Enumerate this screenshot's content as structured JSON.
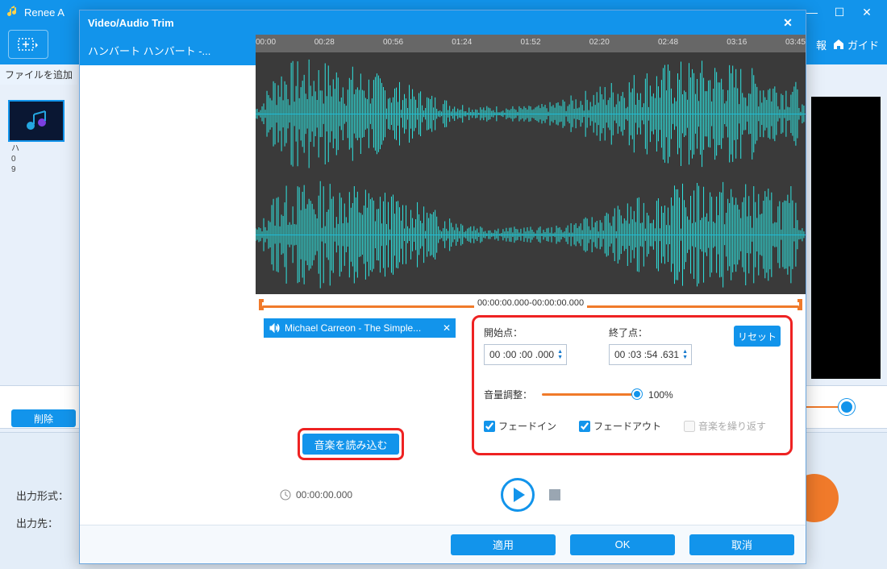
{
  "app": {
    "title": "Renee A",
    "add_file_label": "ファイルを追加",
    "toolbar_info": "報",
    "toolbar_guide": "ガイド"
  },
  "file_item": {
    "line1": "ハ",
    "line2": "0",
    "line3": "9"
  },
  "delete_label": "削除",
  "output": {
    "format_label": "出力形式：",
    "dest_label": "出力先："
  },
  "modal": {
    "title": "Video/Audio Trim",
    "track_name": "ハンバート ハンバート -...",
    "ruler_ticks": [
      "00:00",
      "00:28",
      "00:56",
      "01:24",
      "01:52",
      "02:20",
      "02:48",
      "03:16",
      "03:45"
    ],
    "trim_range_text": "00:00:00.000-00:00:00.000",
    "nowplaying": "Michael Carreon - The Simple...",
    "start_label": "開始点：",
    "end_label": "終了点：",
    "start_value": "00 :00 :00 .000",
    "end_value": "00 :03 :54 .631",
    "reset_label": "リセット",
    "volume_label": "音量調整：",
    "volume_pct": "100%",
    "fade_in": "フェードイン",
    "fade_out": "フェードアウト",
    "repeat": "音楽を繰り返す",
    "load_music": "音楽を読み込む",
    "clock": "00:00:00.000",
    "apply": "適用",
    "ok": "OK",
    "cancel": "取消"
  }
}
